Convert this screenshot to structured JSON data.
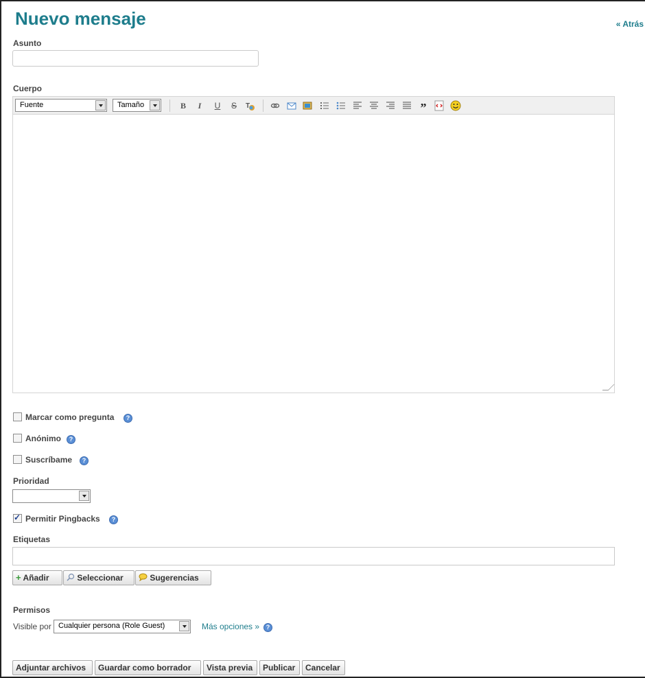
{
  "header": {
    "title": "Nuevo mensaje",
    "back_link": "« Atrás"
  },
  "subject": {
    "label": "Asunto",
    "value": ""
  },
  "body": {
    "label": "Cuerpo",
    "font_select": "Fuente",
    "size_select": "Tamaño",
    "toolbar": {
      "bold": "B",
      "italic": "I",
      "underline": "U",
      "strike": "S",
      "quote": "”"
    }
  },
  "options": {
    "question": {
      "label": "Marcar como pregunta",
      "checked": false
    },
    "anonymous": {
      "label": "Anónimo",
      "checked": false
    },
    "subscribe": {
      "label": "Suscríbame",
      "checked": false
    }
  },
  "priority": {
    "label": "Prioridad",
    "value": ""
  },
  "pingbacks": {
    "label": "Permitir Pingbacks",
    "checked": true
  },
  "tags": {
    "label": "Etiquetas",
    "value": "",
    "add_label": "Añadir",
    "select_label": "Seleccionar",
    "suggestions_label": "Sugerencias"
  },
  "permissions": {
    "label": "Permisos",
    "visible_by_label": "Visible por",
    "visible_by_value": "Cualquier persona (Role Guest)",
    "more_options": "Más opciones »"
  },
  "actions": {
    "attach": "Adjuntar archivos",
    "save_draft": "Guardar como borrador",
    "preview": "Vista previa",
    "publish": "Publicar",
    "cancel": "Cancelar"
  },
  "colors": {
    "accent": "#1e7d8c",
    "help": "#5a8fd6"
  }
}
